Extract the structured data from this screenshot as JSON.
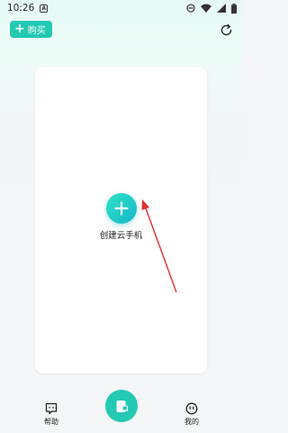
{
  "status_bar": {
    "time": "10:26",
    "app_icon": "A"
  },
  "top_bar": {
    "buy_label": "购买"
  },
  "card": {
    "create_label": "创建云手机"
  },
  "bottom_nav": {
    "help_label": "帮助",
    "mine_label": "我的"
  },
  "colors": {
    "accent": "#23c9b3",
    "arrow": "#e0322f"
  }
}
